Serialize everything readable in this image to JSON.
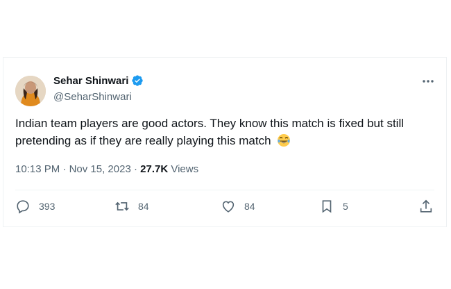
{
  "author": {
    "name": "Sehar Shinwari",
    "handle": "@SeharShinwari",
    "verified": true,
    "verified_color": "#1d9bf0"
  },
  "tweet": {
    "text": "Indian team players are good actors. They know this match is fixed but still pretending as if they are really playing this match",
    "emoji": "laughing-with-tears"
  },
  "meta": {
    "time": "10:13 PM",
    "date": "Nov 15, 2023",
    "views_count": "27.7K",
    "views_label": "Views"
  },
  "actions": {
    "replies": "393",
    "reposts": "84",
    "likes": "84",
    "bookmarks": "5"
  },
  "colors": {
    "muted": "#536471",
    "text": "#0f1419",
    "accent": "#1d9bf0"
  },
  "icons": [
    "more-icon",
    "verified-badge-icon",
    "reply-icon",
    "repost-icon",
    "like-icon",
    "bookmark-icon",
    "share-icon"
  ]
}
